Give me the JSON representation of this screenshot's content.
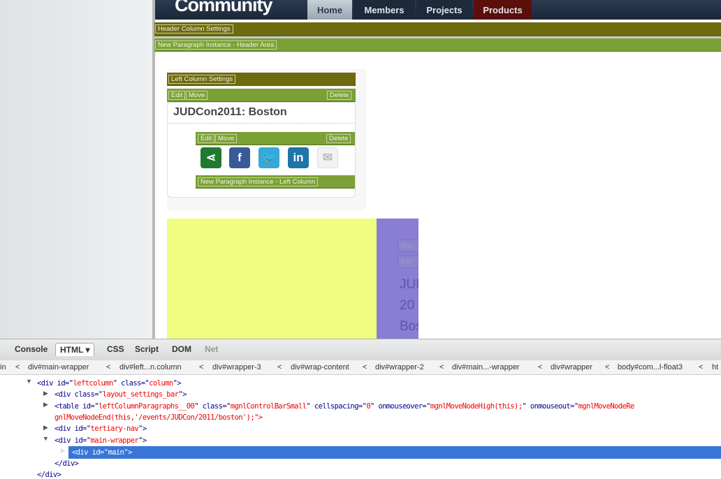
{
  "header": {
    "logo": "Community",
    "nav": [
      "Home",
      "Members",
      "Projects",
      "Products"
    ]
  },
  "cms": {
    "header_settings": "Header Column Settings",
    "header_new": "New Paragraph Instance - Header Area",
    "left_settings": "Left Column Settings",
    "edit": "Edit",
    "move": "Move",
    "delete": "Delete",
    "left_new": "New Paragraph Instance - Left Column",
    "main_btn": "Main",
    "edit_btn": "Edit"
  },
  "content": {
    "title": "JUDCon2011: Boston",
    "purple_text": [
      "JUD",
      "20",
      "Bos"
    ]
  },
  "social": [
    {
      "name": "share",
      "glyph": "<"
    },
    {
      "name": "facebook",
      "glyph": "f"
    },
    {
      "name": "twitter",
      "glyph": "t"
    },
    {
      "name": "linkedin",
      "glyph": "in"
    },
    {
      "name": "email",
      "glyph": "✉"
    }
  ],
  "devtools": {
    "tabs": [
      "Console",
      "HTML ▾",
      "CSS",
      "Script",
      "DOM",
      "Net"
    ],
    "breadcrumbs": [
      "in",
      "<",
      "div#main-wrapper",
      "<",
      "div#left...n.column",
      "<",
      "div#wrapper-3",
      "<",
      "div#wrap-content",
      "<",
      "div#wrapper-2",
      "<",
      "div#main...-wrapper",
      "<",
      "div#wrapper",
      "<",
      "body#com...l-float3",
      "<",
      "ht"
    ],
    "tree": {
      "l1a": "<div id=\"",
      "l1b": "leftcolumn",
      "l1c": "\" class=\"",
      "l1d": "column",
      "l1e": "\">",
      "l2a": "<div class=\"",
      "l2b": "layout_settings_bar",
      "l2c": "\">",
      "l3a": "<table id=\"",
      "l3b": "leftColumnParagraphs__00",
      "l3c": "\" class=\"",
      "l3d": "mgnlControlBarSmall",
      "l3e": "\" cellspacing=\"",
      "l3f": "0",
      "l3g": "\" onmouseover=\"",
      "l3h": "mgnlMoveNodeHigh(this);",
      "l3i": "\" onmouseout=\"",
      "l3j": "mgnlMoveNodeRe",
      "l4": "gnlMoveNodeEnd(this,'/events/JUDCon/2011/boston');\">",
      "l5a": "<div id=\"",
      "l5b": "tertiary-nav",
      "l5c": "\">",
      "l6a": "<div id=\"",
      "l6b": "main-wrapper",
      "l6c": "\">",
      "l7": "<div id=\"main\">",
      "l8": "</div>",
      "l9": "</div>"
    }
  }
}
